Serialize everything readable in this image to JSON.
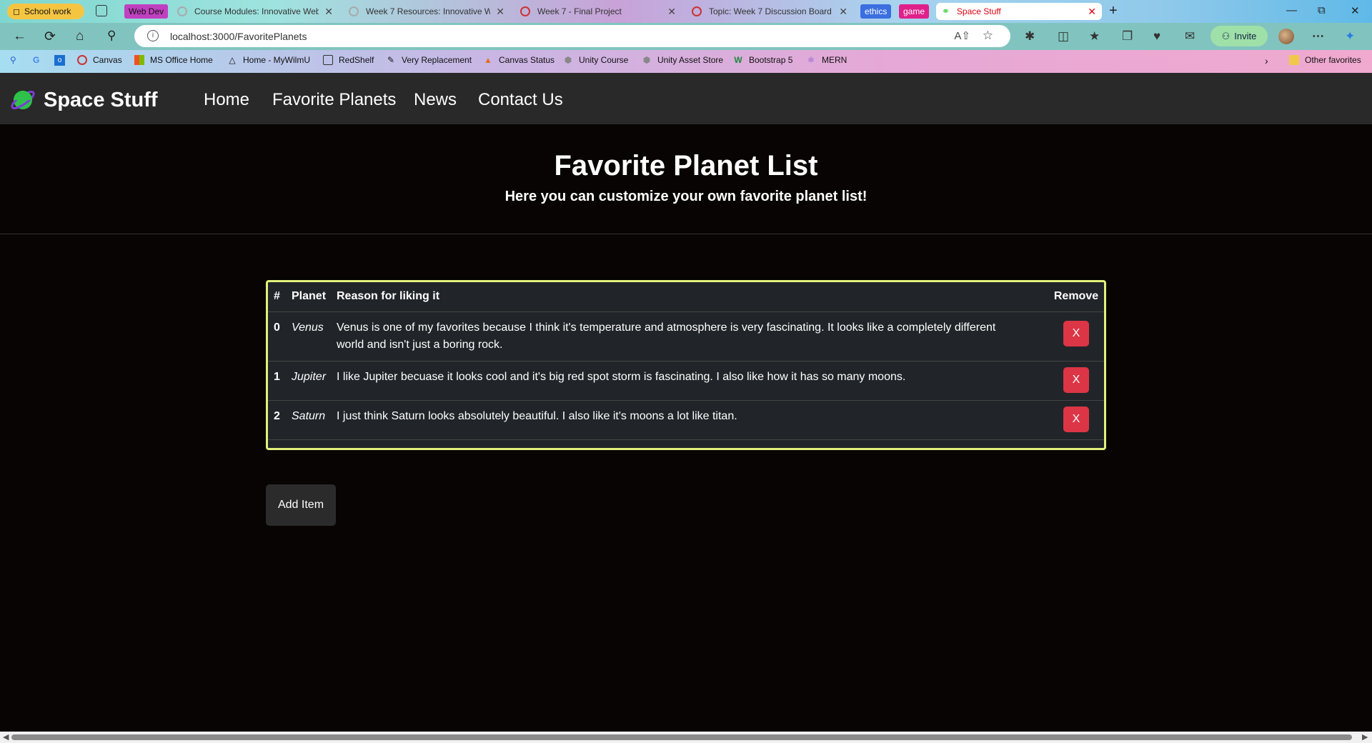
{
  "browser": {
    "tab_groups": [
      {
        "label": "School work",
        "color": "#f5c542"
      },
      {
        "label": "Web Dev",
        "color": "#c040c0"
      },
      {
        "label": "ethics",
        "color": "#3b6fe0"
      },
      {
        "label": "game",
        "color": "#e0208a"
      }
    ],
    "tabs": [
      {
        "title": "Course Modules: Innovative Web"
      },
      {
        "title": "Week 7 Resources: Innovative W"
      },
      {
        "title": "Week 7 - Final Project"
      },
      {
        "title": "Topic: Week 7 Discussion Board"
      },
      {
        "title": "Space Stuff"
      }
    ],
    "url": "localhost:3000/FavoritePlanets",
    "invite_label": "Invite",
    "favorites": [
      {
        "label": "Canvas"
      },
      {
        "label": "MS Office Home"
      },
      {
        "label": "Home - MyWilmU"
      },
      {
        "label": "RedShelf"
      },
      {
        "label": "Very Replacement"
      },
      {
        "label": "Canvas Status"
      },
      {
        "label": "Unity Course"
      },
      {
        "label": "Unity Asset Store"
      },
      {
        "label": "Bootstrap 5"
      },
      {
        "label": "MERN"
      }
    ],
    "other_favorites": "Other favorites"
  },
  "site": {
    "brand": "Space Stuff",
    "nav": [
      "Home",
      "Favorite Planets",
      "News",
      "Contact Us"
    ]
  },
  "hero": {
    "title": "Favorite Planet List",
    "subtitle": "Here you can customize your own favorite planet list!"
  },
  "table": {
    "headers": [
      "#",
      "Planet",
      "Reason for liking it",
      "Remove"
    ],
    "rows": [
      {
        "num": "0",
        "planet": "Venus",
        "reason": "Venus is one of my favorites because I think it's temperature and atmosphere is very fascinating. It looks like a completely different world and isn't just a boring rock.",
        "remove": "X"
      },
      {
        "num": "1",
        "planet": "Jupiter",
        "reason": "I like Jupiter becuase it looks cool and it's big red spot storm is fascinating. I also like how it has so many moons.",
        "remove": "X"
      },
      {
        "num": "2",
        "planet": "Saturn",
        "reason": "I just think Saturn looks absolutely beautiful. I also like it's moons a lot like titan.",
        "remove": "X"
      }
    ]
  },
  "add_button": "Add Item",
  "colors": {
    "page_bg": "#070403",
    "navbar_bg": "#292929",
    "table_border": "#e3f07a",
    "remove_button": "#dc3545"
  }
}
